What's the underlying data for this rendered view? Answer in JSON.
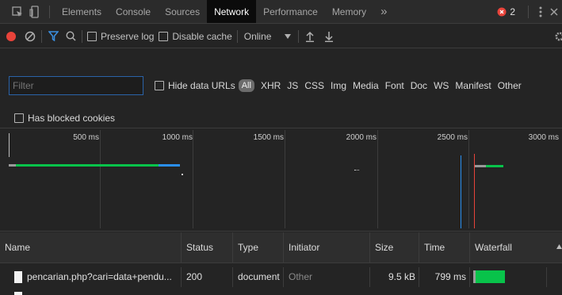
{
  "tabs": {
    "items": [
      "Elements",
      "Console",
      "Sources",
      "Network",
      "Performance",
      "Memory"
    ],
    "active": "Network",
    "more": "»",
    "error_count": "2"
  },
  "toolbar": {
    "preserve_log": "Preserve log",
    "disable_cache": "Disable cache",
    "throttling": "Online"
  },
  "filter": {
    "placeholder": "Filter",
    "hide_data_urls": "Hide data URLs",
    "all": "All",
    "types": [
      "XHR",
      "JS",
      "CSS",
      "Img",
      "Media",
      "Font",
      "Doc",
      "WS",
      "Manifest",
      "Other"
    ],
    "has_blocked_cookies": "Has blocked cookies"
  },
  "timeline": {
    "ticks": [
      "500 ms",
      "1000 ms",
      "1500 ms",
      "2000 ms",
      "2500 ms",
      "3000 ms"
    ]
  },
  "table": {
    "headers": [
      "Name",
      "Status",
      "Type",
      "Initiator",
      "Size",
      "Time",
      "Waterfall"
    ],
    "rows": [
      {
        "name": "pencarian.php?cari=data+pendu...",
        "status": "200",
        "type": "document",
        "initiator": "Other",
        "size": "9.5 kB",
        "time": "799 ms",
        "waterfall_pct": 0.8
      }
    ]
  },
  "colors": {
    "bg": "#242424",
    "active_tab": "#0b0b0b",
    "record_red": "#e8433a",
    "filter_blue": "#3b8fe0",
    "waterfall_green": "#08c34a",
    "dom_blue": "#2a8ff0",
    "load_red": "#e8433a"
  }
}
